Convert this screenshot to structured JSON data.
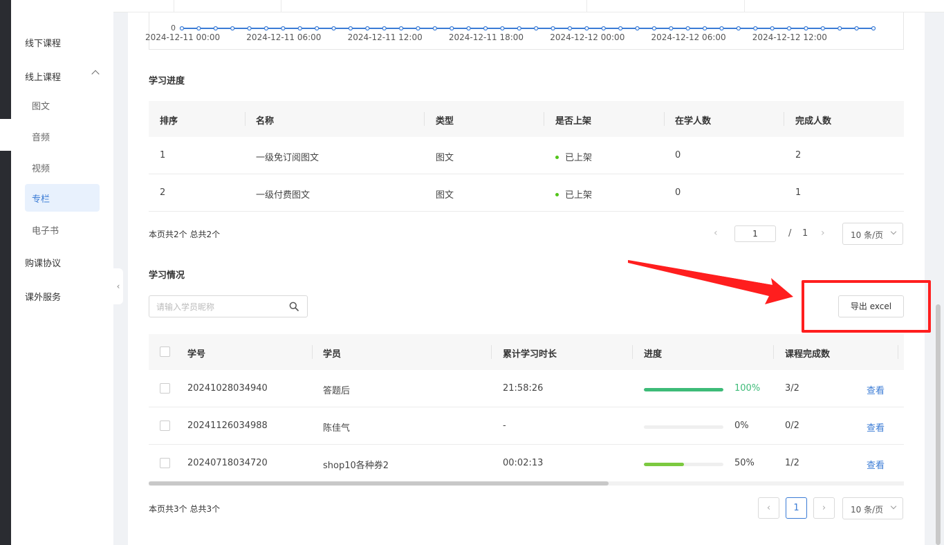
{
  "sidebar": {
    "items": [
      {
        "label": "线下课程"
      },
      {
        "label": "线上课程"
      },
      {
        "label": "购课协议"
      },
      {
        "label": "课外服务"
      }
    ],
    "online_sub": [
      {
        "label": "图文"
      },
      {
        "label": "音频"
      },
      {
        "label": "视频"
      },
      {
        "label": "专栏"
      },
      {
        "label": "电子书"
      }
    ],
    "active_sub": "专栏"
  },
  "chart_data": {
    "type": "line",
    "x": [
      "2024-12-11 00:00",
      "2024-12-11 06:00",
      "2024-12-11 12:00",
      "2024-12-11 18:00",
      "2024-12-12 00:00",
      "2024-12-12 06:00",
      "2024-12-12 12:00"
    ],
    "point_count": 42,
    "values_all": 0,
    "y_tick": "0",
    "color": "#3a7bd5"
  },
  "progress": {
    "title": "学习进度",
    "columns": [
      "排序",
      "名称",
      "类型",
      "是否上架",
      "在学人数",
      "完成人数"
    ],
    "rows": [
      {
        "order": "1",
        "name": "一级免订阅图文",
        "type": "图文",
        "status": "已上架",
        "learning": "0",
        "done": "2"
      },
      {
        "order": "2",
        "name": "一级付费图文",
        "type": "图文",
        "status": "已上架",
        "learning": "0",
        "done": "1"
      }
    ],
    "summary": "本页共2个 总共2个",
    "page_current": "1",
    "page_slash": "/",
    "page_total": "1",
    "page_size": "10 条/页",
    "status_color": "#52c41a"
  },
  "study": {
    "title": "学习情况",
    "search_placeholder": "请输入学员昵称",
    "export_label": "导出 excel",
    "columns": [
      "学号",
      "学员",
      "累计学习时长",
      "进度",
      "课程完成数"
    ],
    "rows": [
      {
        "id": "20241028034940",
        "name": "答题后",
        "duration": "21:58:26",
        "progress": 100,
        "progress_label": "100%",
        "count": "3/2",
        "action": "查看",
        "bar_color": "#3dbb78"
      },
      {
        "id": "20241126034988",
        "name": "陈佳气",
        "duration": "-",
        "progress": 0,
        "progress_label": "0%",
        "count": "0/2",
        "action": "查看",
        "bar_color": "#3dbb78"
      },
      {
        "id": "20240718034720",
        "name": "shop10各种券2",
        "duration": "00:02:13",
        "progress": 50,
        "progress_label": "50%",
        "count": "1/2",
        "action": "查看",
        "bar_color": "#7cc940"
      }
    ],
    "summary": "本页共3个 总共3个",
    "page_current": "1",
    "page_size": "10 条/页",
    "prev": "‹",
    "next": "›"
  },
  "colors": {
    "accent": "#3a7bd5",
    "annotation": "#ff1e1e"
  }
}
